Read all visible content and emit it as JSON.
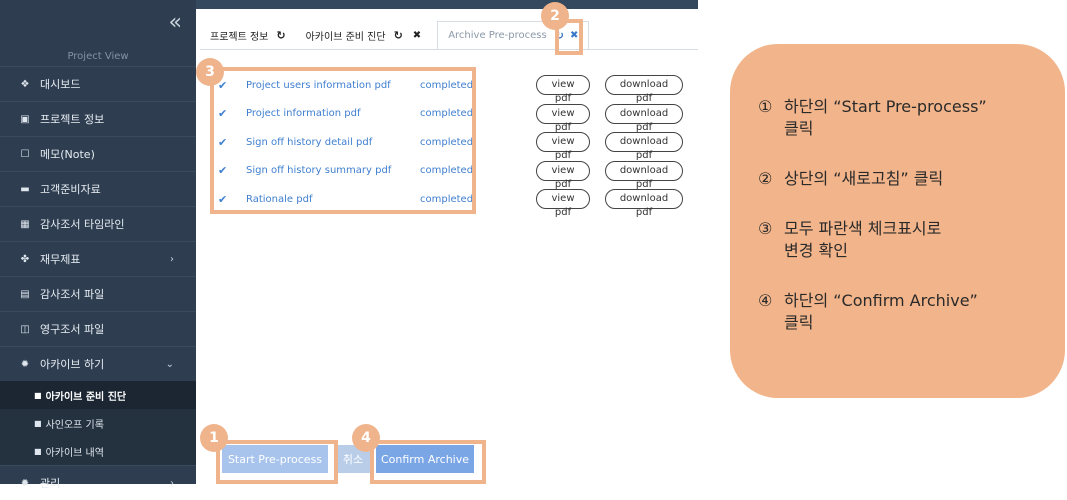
{
  "sidebar": {
    "collapse_icon": "double-chevron-left",
    "project_view": "Project View",
    "items": [
      {
        "label": "대시보드",
        "icon": "home-icon",
        "glyph": "❖"
      },
      {
        "label": "프로젝트 정보",
        "icon": "info-icon",
        "glyph": "▣"
      },
      {
        "label": "메모(Note)",
        "icon": "note-icon",
        "glyph": "☐"
      },
      {
        "label": "고객준비자료",
        "icon": "card-icon",
        "glyph": "▬"
      },
      {
        "label": "감사조서 타임라인",
        "icon": "calendar-icon",
        "glyph": "▦"
      },
      {
        "label": "재무제표",
        "icon": "cubes-icon",
        "glyph": "✤"
      },
      {
        "label": "감사조서 파일",
        "icon": "file-icon",
        "glyph": "▤"
      },
      {
        "label": "영구조서 파일",
        "icon": "copy-icon",
        "glyph": "◫"
      },
      {
        "label": "아카이브 하기",
        "icon": "gear-icon",
        "glyph": "✹"
      }
    ],
    "sub_items": [
      {
        "label": "아카이브 준비 진단",
        "glyph": "■"
      },
      {
        "label": "사인오프 기록",
        "glyph": "■"
      },
      {
        "label": "아카이브 내역",
        "glyph": "■"
      }
    ],
    "last_item": {
      "label": "관리",
      "glyph": "✹"
    }
  },
  "tabs": [
    {
      "label": "프로젝트 정보"
    },
    {
      "label": "아카이브 준비 진단"
    },
    {
      "label": "Archive Pre-process"
    }
  ],
  "files": [
    {
      "name": "Project users information pdf",
      "status": "completed"
    },
    {
      "name": "Project information pdf",
      "status": "completed"
    },
    {
      "name": "Sign off history detail pdf",
      "status": "completed"
    },
    {
      "name": "Sign off history summary pdf",
      "status": "completed"
    },
    {
      "name": "Rationale pdf",
      "status": "completed"
    }
  ],
  "file_actions": {
    "view": "view pdf",
    "download": "download pdf"
  },
  "buttons": {
    "start": "Start Pre-process",
    "cancel": "취소",
    "confirm": "Confirm Archive"
  },
  "badges": [
    "1",
    "2",
    "3",
    "4"
  ],
  "instructions": [
    {
      "num": "①",
      "text": "하단의 “Start Pre-process”\n클릭"
    },
    {
      "num": "②",
      "text": "상단의 “새로고침” 클릭"
    },
    {
      "num": "③",
      "text": "모두 파란색 체크표시로\n변경 확인"
    },
    {
      "num": "④",
      "text": "하단의 “Confirm Archive”\n클릭"
    }
  ],
  "colors": {
    "sidebar": "#2e3e50",
    "highlight": "#f0b48c",
    "link_blue": "#3f7fd0",
    "panel": "#f2b48a"
  }
}
